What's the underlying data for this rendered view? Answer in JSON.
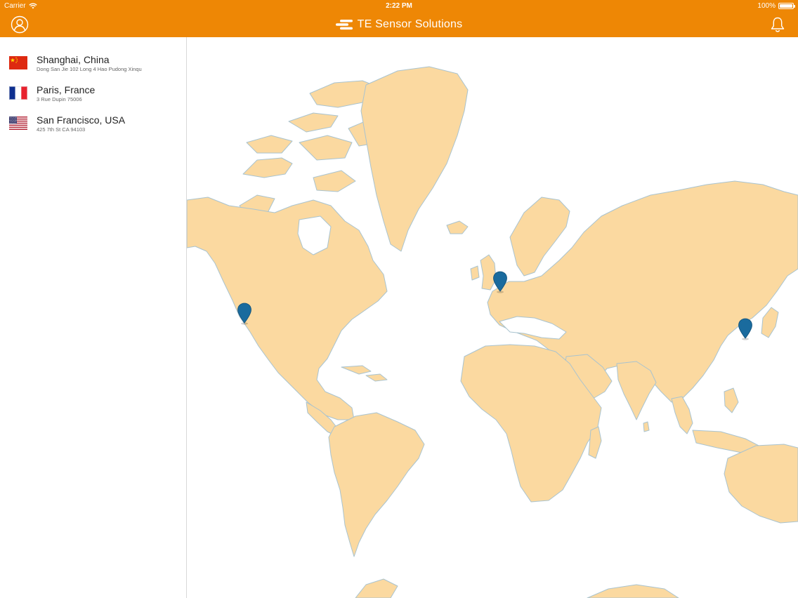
{
  "status_bar": {
    "carrier": "Carrier",
    "time": "2:22 PM",
    "battery_text": "100%",
    "battery_level": 1.0
  },
  "header": {
    "title": "TE Sensor Solutions",
    "left_icon": "profile-icon",
    "right_icon": "bell-icon",
    "logo_icon": "te-logo-icon",
    "background_color": "#ee8705"
  },
  "locations": [
    {
      "name": "Shanghai, China",
      "address": "Dong San Jie 102 Long 4 Hao Pudong Xinqu",
      "flag": "china-flag-icon"
    },
    {
      "name": "Paris, France",
      "address": "3 Rue Dupin 75006",
      "flag": "france-flag-icon"
    },
    {
      "name": "San Francisco, USA",
      "address": "425 7th St CA 94103",
      "flag": "usa-flag-icon"
    }
  ],
  "map": {
    "land_color": "#fbd9a0",
    "border_color": "#a9c3cf",
    "pin_color": "#1a6b9e",
    "pin_icon": "map-pin-icon"
  }
}
